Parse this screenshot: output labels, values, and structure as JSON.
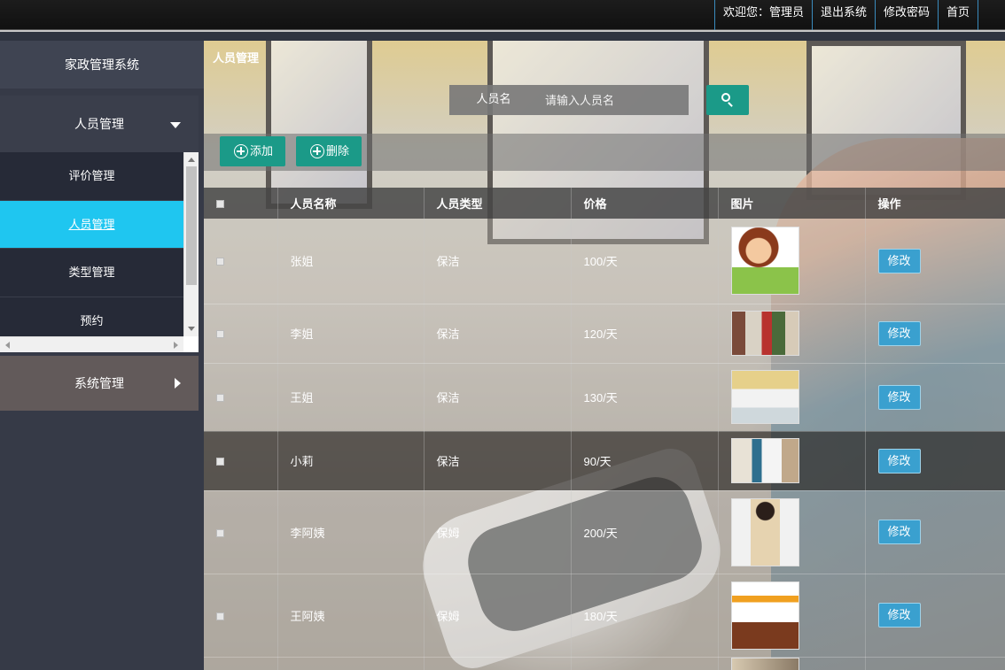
{
  "topbar": {
    "welcome": "欢迎您：管理员",
    "logout": "退出系统",
    "change_password": "修改密码",
    "home": "首页"
  },
  "sidebar": {
    "system_title": "家政管理系统",
    "group1": {
      "label": "人员管理",
      "items": [
        {
          "label": "评价管理"
        },
        {
          "label": "人员管理"
        },
        {
          "label": "类型管理"
        },
        {
          "label": "预约"
        }
      ]
    },
    "group2": {
      "label": "系统管理"
    }
  },
  "main": {
    "breadcrumb": "人员管理",
    "search": {
      "label": "人员名",
      "placeholder": "请输入人员名"
    },
    "toolbar": {
      "add": "添加",
      "delete": "删除"
    },
    "table": {
      "headers": [
        "人员名称",
        "人员类型",
        "价格",
        "图片",
        "操作"
      ],
      "edit_label": "修改",
      "rows": [
        {
          "name": "张姐",
          "type": "保洁",
          "price": "100/天"
        },
        {
          "name": "李姐",
          "type": "保洁",
          "price": "120/天"
        },
        {
          "name": "王姐",
          "type": "保洁",
          "price": "130/天"
        },
        {
          "name": "小莉",
          "type": "保洁",
          "price": "90/天"
        },
        {
          "name": "李阿姨",
          "type": "保姆",
          "price": "200/天"
        },
        {
          "name": "王阿姨",
          "type": "保姆",
          "price": "180/天"
        }
      ]
    }
  },
  "colors": {
    "accent_teal": "#1b9a88",
    "active_menu": "#1fc6f0",
    "edit_button": "#3aa0cf"
  }
}
